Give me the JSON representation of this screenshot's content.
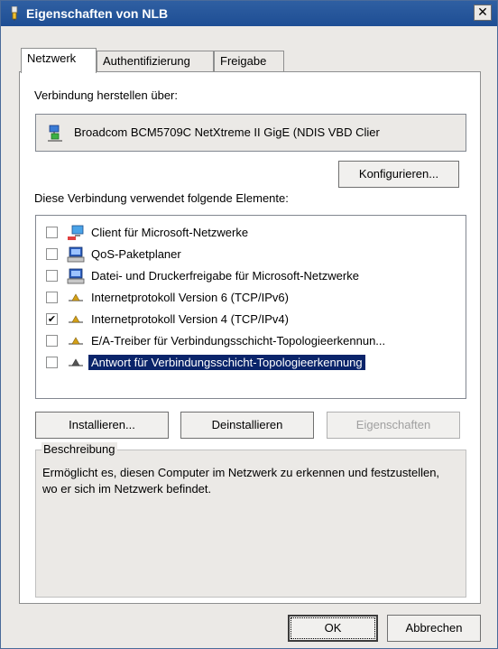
{
  "window": {
    "title": "Eigenschaften von NLB",
    "close_glyph": "✕"
  },
  "tabs": [
    {
      "label": "Netzwerk",
      "active": true
    },
    {
      "label": "Authentifizierung",
      "active": false
    },
    {
      "label": "Freigabe",
      "active": false
    }
  ],
  "connect_via": {
    "label": "Verbindung herstellen über:",
    "adapter_name": "Broadcom BCM5709C NetXtreme II GigE (NDIS VBD Clier",
    "icon": "network-adapter-icon"
  },
  "configure_button": "Konfigurieren...",
  "elements": {
    "label": "Diese Verbindung verwendet folgende Elemente:",
    "items": [
      {
        "label": "Client für Microsoft-Netzwerke",
        "checked": false,
        "selected": false,
        "icon": "network-client-icon"
      },
      {
        "label": "QoS-Paketplaner",
        "checked": false,
        "selected": false,
        "icon": "service-computer-icon"
      },
      {
        "label": "Datei- und Druckerfreigabe für Microsoft-Netzwerke",
        "checked": false,
        "selected": false,
        "icon": "service-computer-icon"
      },
      {
        "label": "Internetprotokoll Version 6 (TCP/IPv6)",
        "checked": false,
        "selected": false,
        "icon": "protocol-icon"
      },
      {
        "label": "Internetprotokoll Version 4 (TCP/IPv4)",
        "checked": true,
        "selected": false,
        "icon": "protocol-icon"
      },
      {
        "label": "E/A-Treiber für Verbindungsschicht-Topologieerkennun...",
        "checked": false,
        "selected": false,
        "icon": "protocol-icon"
      },
      {
        "label": "Antwort für Verbindungsschicht-Topologieerkennung",
        "checked": false,
        "selected": true,
        "icon": "protocol-icon"
      }
    ]
  },
  "actions": {
    "install": "Installieren...",
    "uninstall": "Deinstallieren",
    "properties": "Eigenschaften"
  },
  "description": {
    "title": "Beschreibung",
    "text": "Ermöglicht es, diesen Computer im Netzwerk zu erkennen und festzustellen, wo er sich im Netzwerk befindet."
  },
  "footer": {
    "ok": "OK",
    "cancel": "Abbrechen"
  },
  "colors": {
    "titlebar": "#1e4e94",
    "selection": "#0a246a",
    "dialog_bg": "#ebe9e6"
  }
}
